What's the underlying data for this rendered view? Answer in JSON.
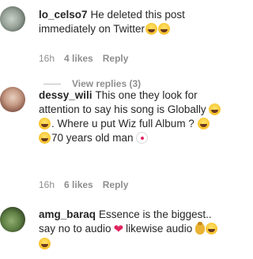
{
  "comments": [
    {
      "username": "lo_celso7",
      "segments": [
        "He deleted this post immediately on Twitter"
      ],
      "emojis_end": [
        "face-with-tears-of-joy",
        "face-with-tears-of-joy"
      ],
      "time": "16h",
      "likes": "4 likes",
      "reply": "Reply",
      "view_replies": "View replies (3)"
    },
    {
      "username": "dessy_wili",
      "segments": [
        "This one they look for attention to say his song is Globally",
        ". Where u put Wiz full Album ?",
        "70 years old man"
      ],
      "time": "16h",
      "likes": "6 likes",
      "reply": "Reply"
    },
    {
      "username": "amg_baraq",
      "segments": [
        "Essence is the biggest.. say no to audio",
        "likewise audio"
      ]
    }
  ]
}
